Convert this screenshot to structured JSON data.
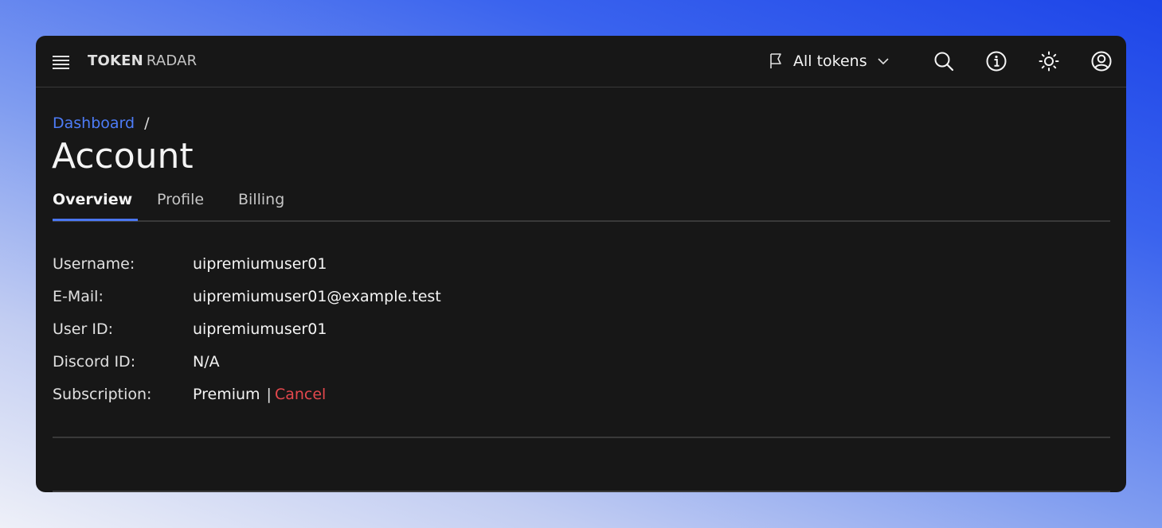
{
  "header": {
    "brand_primary": "TOKEN",
    "brand_secondary": "RADAR",
    "token_select_label": "All tokens"
  },
  "breadcrumb": {
    "link": "Dashboard",
    "separator": "/"
  },
  "page": {
    "title": "Account"
  },
  "tabs": [
    {
      "label": "Overview",
      "active": true
    },
    {
      "label": "Profile",
      "active": false
    },
    {
      "label": "Billing",
      "active": false
    }
  ],
  "account": {
    "rows": [
      {
        "key": "Username:",
        "value": "uipremiumuser01"
      },
      {
        "key": "E-Mail:",
        "value": "uipremiumuser01@example.test"
      },
      {
        "key": "User ID:",
        "value": "uipremiumuser01"
      },
      {
        "key": "Discord ID:",
        "value": "N/A"
      },
      {
        "key": "Subscription:",
        "value": "Premium"
      }
    ],
    "subscription_separator": "|",
    "cancel_label": "Cancel"
  },
  "icons": {
    "menu": "hamburger-menu-icon",
    "token_flag": "flag-icon",
    "token_chevron": "chevron-down-icon",
    "search": "search-icon",
    "info": "info-icon",
    "theme": "sun-icon",
    "user": "user-avatar-icon"
  },
  "colors": {
    "background_panel": "#171717",
    "link": "#4d7cf7",
    "tab_active_indicator": "#4a76f0",
    "cancel": "#e5484d"
  }
}
